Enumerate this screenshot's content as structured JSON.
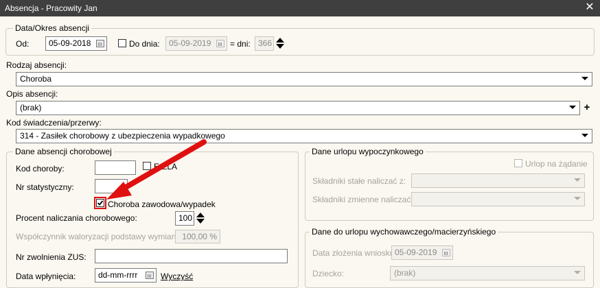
{
  "window": {
    "title": "Absencja - Pracowity Jan",
    "close": "✕"
  },
  "period": {
    "legend": "Data/Okres absencji",
    "from_label": "Od:",
    "from_value": "05-09-2018",
    "until_checkbox_label": "Do dnia:",
    "until_value": "05-09-2019",
    "days_label": "= dni:",
    "days_value": "366"
  },
  "absence_type": {
    "label": "Rodzaj absencji:",
    "value": "Choroba"
  },
  "absence_desc": {
    "label": "Opis absencji:",
    "value": "(brak)",
    "add": "+"
  },
  "benefit_code": {
    "label": "Kod świadczenia/przerwy:",
    "value": "314 - Zasiłek chorobowy z ubezpieczenia wypadkowego"
  },
  "sick": {
    "legend": "Dane absencji chorobowej",
    "disease_code_label": "Kod choroby:",
    "disease_code_value": "",
    "ezla_label": "E-ZLA",
    "stat_no_label": "Nr statystyczny:",
    "stat_no_value": "",
    "occupational_label": "Choroba zawodowa/wypadek",
    "occupational_checked": true,
    "percent_label": "Procent naliczania chorobowego:",
    "percent_value": "100",
    "valorization_label": "Współczynnik waloryzacji podstawy wymiaru:",
    "valorization_value": "100,00 %",
    "zus_label": "Nr zwolnienia ZUS:",
    "zus_value": "",
    "inflow_label": "Data wpłynięcia:",
    "inflow_value": "dd-mm-rrrr",
    "clear_link": "Wyczyść"
  },
  "vacation": {
    "legend": "Dane urlopu wypoczynkowego",
    "on_demand_label": "Urlop na żądanie",
    "fixed_label": "Składniki stałe naliczać z:",
    "fixed_value": "",
    "variable_label": "Składniki zmienne naliczać z:",
    "variable_value": ""
  },
  "parental": {
    "legend": "Dane do urlopu wychowawczego/macierzyńskiego",
    "application_label": "Data złożenia wniosku:",
    "application_value": "05-09-2019",
    "child_label": "Dziecko:",
    "child_value": "(brak)"
  },
  "colors": {
    "titlebar": "#3f3f3f",
    "background": "#fbf8f1",
    "annotation": "#e01010"
  }
}
